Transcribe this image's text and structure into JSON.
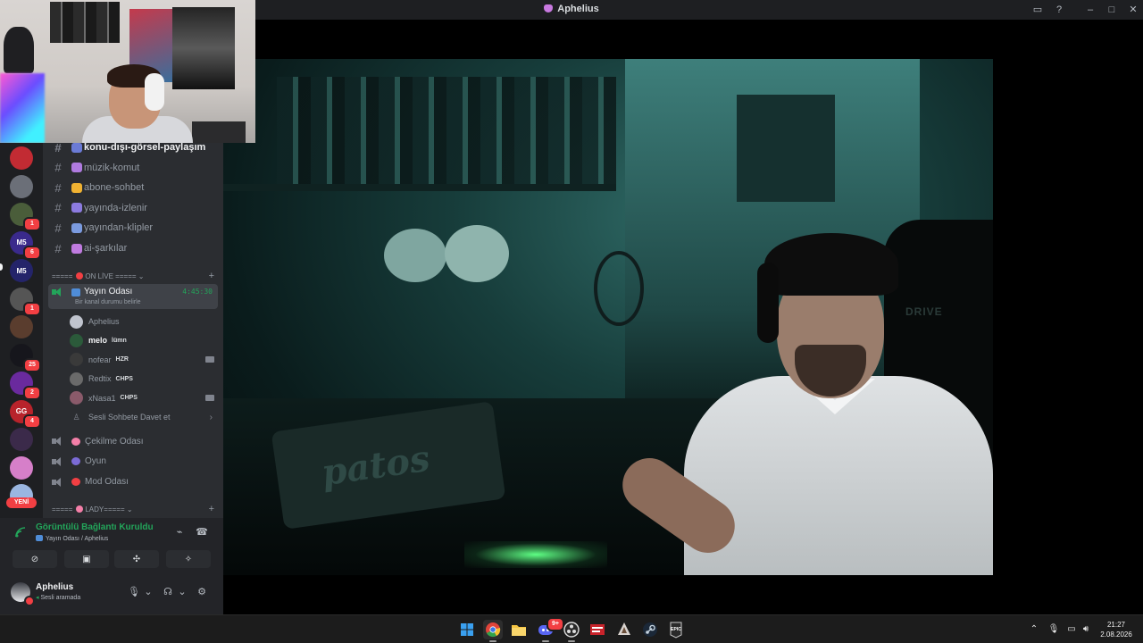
{
  "window": {
    "title": "Aphelius"
  },
  "rail": {
    "new_label": "YENİ",
    "servers": [
      {
        "name": "srv-1",
        "color": "#c22b33",
        "label": "",
        "badge": ""
      },
      {
        "name": "srv-2",
        "color": "#6b6f78",
        "label": "",
        "badge": ""
      },
      {
        "name": "srv-3",
        "color": "#4a5d3a",
        "label": "",
        "badge": "1"
      },
      {
        "name": "srv-4",
        "color": "#3a2a8c",
        "label": "M5",
        "badge": "6"
      },
      {
        "name": "srv-5",
        "color": "#24246a",
        "label": "M5",
        "badge": ""
      },
      {
        "name": "srv-6",
        "color": "#555",
        "label": "",
        "badge": "1"
      },
      {
        "name": "srv-7",
        "color": "#5a3d2e",
        "label": "",
        "badge": ""
      },
      {
        "name": "srv-8",
        "color": "#16161c",
        "label": "",
        "badge": "25"
      },
      {
        "name": "srv-9",
        "color": "#6a2a9e",
        "label": "",
        "badge": "2"
      },
      {
        "name": "srv-10",
        "color": "#b8232b",
        "label": "GG",
        "badge": "4"
      },
      {
        "name": "srv-11",
        "color": "#3b2a4a",
        "label": "",
        "badge": ""
      },
      {
        "name": "srv-12",
        "color": "#d67fc9",
        "label": "",
        "badge": ""
      },
      {
        "name": "srv-13",
        "color": "#9ab6e0",
        "label": "",
        "badge": ""
      }
    ]
  },
  "channels": {
    "text": [
      {
        "name": "konu-dışı-görsel-paylaşım",
        "emoji_color": "#6b7bd6",
        "active": true
      },
      {
        "name": "müzik-komut",
        "emoji_color": "#b07be0"
      },
      {
        "name": "abone-sohbet",
        "emoji_color": "#f0b232"
      },
      {
        "name": "yayında-izlenir",
        "emoji_color": "#8c7be0"
      },
      {
        "name": "yayından-klipler",
        "emoji_color": "#7b9be0"
      },
      {
        "name": "ai-şarkılar",
        "emoji_color": "#c07be0"
      }
    ],
    "category_live": {
      "label": "ON LİVE",
      "prefix": "=====",
      "suffix": "=====",
      "dot_color": "#f23f43"
    },
    "live_channel": {
      "name": "Yayın Odası",
      "timer": "4:45:30",
      "status": "Bir kanal durumu belirle"
    },
    "members": [
      {
        "name": "Aphelius",
        "tag": "",
        "color": "#c0c4ce",
        "camera": false
      },
      {
        "name": "melo",
        "tag": "lümn",
        "color": "#2b5a3a",
        "camera": false
      },
      {
        "name": "nofear",
        "tag": "HZR",
        "color": "#3a3a3a",
        "camera": true
      },
      {
        "name": "Redtix",
        "tag": "CHPS",
        "color": "#6a6a6a",
        "camera": false
      },
      {
        "name": "xNasa1",
        "tag": "CHPS",
        "color": "#8a5a6a",
        "camera": true
      }
    ],
    "invite": "Sesli Sohbete Davet et",
    "voice": [
      {
        "name": "Çekilme Odası",
        "emoji_color": "#f47fa8"
      },
      {
        "name": "Oyun",
        "emoji_color": "#7b6bd6"
      },
      {
        "name": "Mod Odası",
        "emoji_color": "#f23f43"
      }
    ],
    "category_lady": {
      "label": "LADY",
      "prefix": "=====",
      "suffix": "=====",
      "dot_color": "#f47fa8"
    }
  },
  "voice_panel": {
    "title": "Görüntülü Bağlantı Kuruldu",
    "subtitle": "Yayın Odası / Aphelius"
  },
  "user": {
    "name": "Aphelius",
    "status": "Sesli aramada"
  },
  "taskbar": {
    "time": "21:27",
    "date": "2.08.2026",
    "discord_badge": "9+"
  }
}
